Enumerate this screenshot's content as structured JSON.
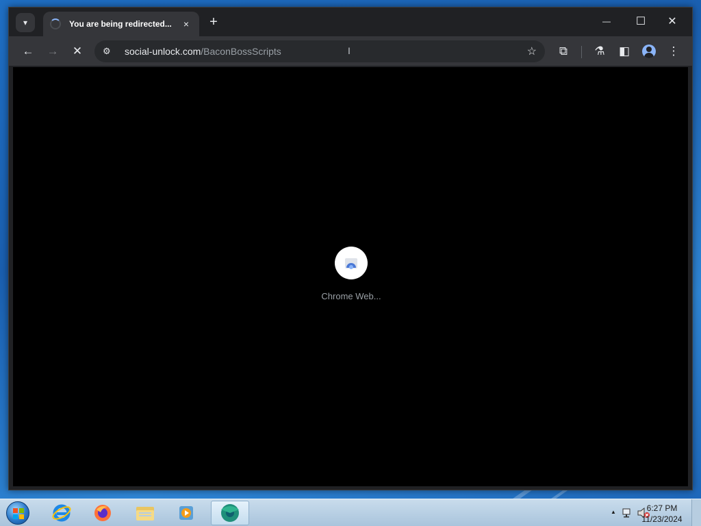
{
  "browser": {
    "tab": {
      "title": "You are being redirected...",
      "close": "×"
    },
    "tab_search_icon": "chevron-down-icon",
    "new_tab": "+",
    "window_controls": {
      "minimize": "—",
      "maximize": "☐",
      "close": "✕"
    },
    "toolbar": {
      "back": "←",
      "forward": "→",
      "stop": "✕",
      "site_info": "⚙",
      "url_domain": "social-unlock.com",
      "url_path": "/BaconBossScripts",
      "bookmark": "☆",
      "extensions": "⧉",
      "labs": "⚗",
      "side_panel": "◧",
      "menu": "⋮"
    },
    "content": {
      "loader_label": "Chrome Web...",
      "background": "#000000"
    }
  },
  "taskbar": {
    "apps": [
      "internet-explorer",
      "firefox",
      "file-explorer",
      "media-player",
      "chrome-active"
    ],
    "tray": {
      "chevron": "▲"
    },
    "clock": {
      "time": "6:27 PM",
      "date": "11/23/2024"
    }
  },
  "colors": {
    "chrome_dark": "#202124",
    "toolbar": "#35363a",
    "accent": "#8ab4f8"
  }
}
